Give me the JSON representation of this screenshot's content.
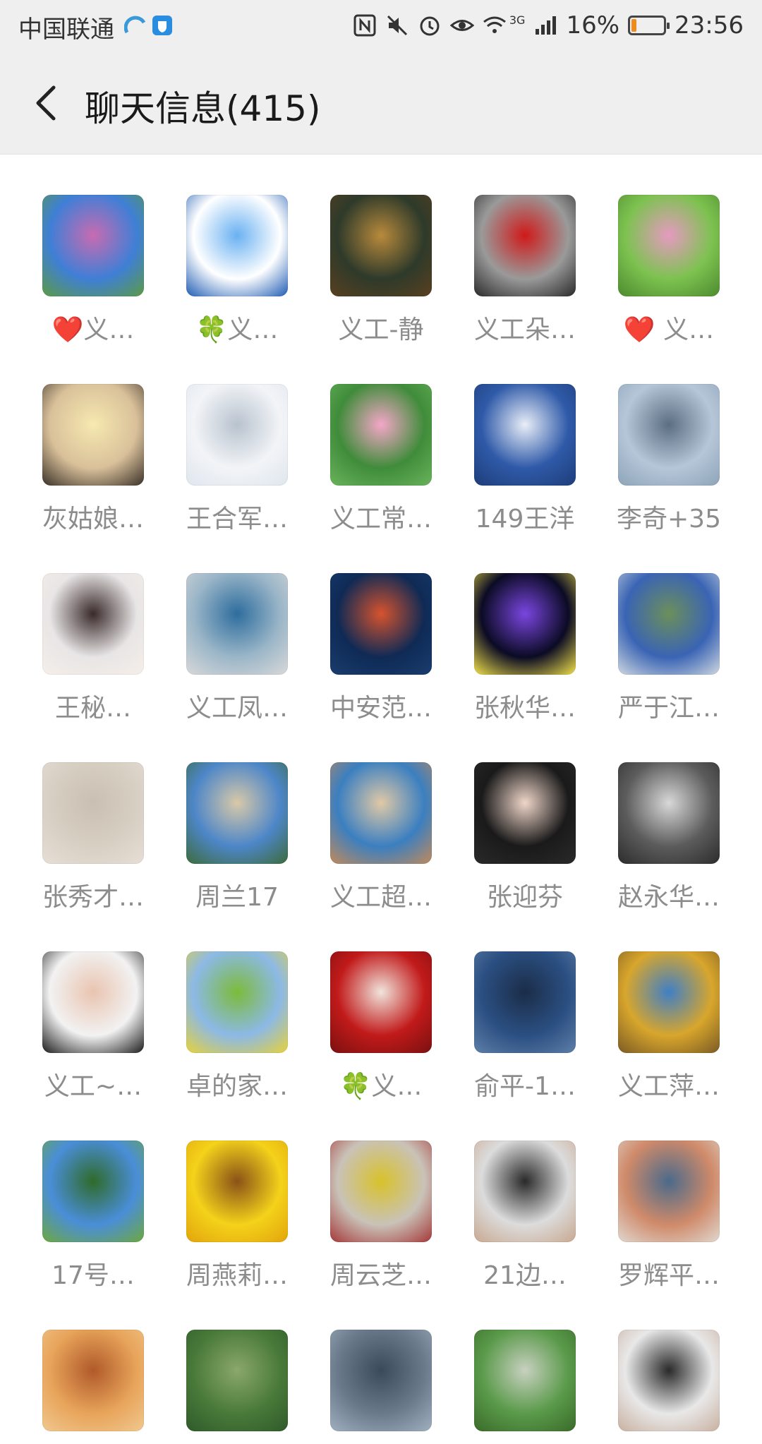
{
  "status_bar": {
    "carrier": "中国联通",
    "network": "3G",
    "battery": "16%",
    "battery_level": 0.16,
    "time": "23:56",
    "icons": [
      "nfc-icon",
      "mute-icon",
      "alarm-icon",
      "eye-comfort-icon",
      "wifi-icon",
      "signal-icon",
      "battery-icon"
    ]
  },
  "header": {
    "back_icon": "back-arrow-icon",
    "title": "聊天信息(415)"
  },
  "members": [
    {
      "name": "❤️义…",
      "photo": "pink-flowers-blue-sky"
    },
    {
      "name": "🍀义…",
      "photo": "blue-sun-burst"
    },
    {
      "name": "义工-静",
      "photo": "golden-dragon"
    },
    {
      "name": "义工朵…",
      "photo": "red-roses-bouquet"
    },
    {
      "name": "❤️ 义…",
      "photo": "pink-lotus-green"
    },
    {
      "name": "灰姑娘…",
      "photo": "sunset-field"
    },
    {
      "name": "王合军…",
      "photo": "snow-hands"
    },
    {
      "name": "义工常…",
      "photo": "pink-lotus"
    },
    {
      "name": "149王洋",
      "photo": "cloud-sky"
    },
    {
      "name": "李奇+35",
      "photo": "lake-landscape"
    },
    {
      "name": "王秘…",
      "photo": "woman-portrait"
    },
    {
      "name": "义工凤…",
      "photo": "ship-deck"
    },
    {
      "name": "中安范…",
      "photo": "cartoon-girl-night"
    },
    {
      "name": "张秋华…",
      "photo": "stage-lights"
    },
    {
      "name": "严于江…",
      "photo": "tower-trees"
    },
    {
      "name": "张秀才…",
      "photo": "beige-pattern"
    },
    {
      "name": "周兰17",
      "photo": "lakeside-buildings"
    },
    {
      "name": "义工超…",
      "photo": "beach-woman"
    },
    {
      "name": "张迎芬",
      "photo": "woman-selfie"
    },
    {
      "name": "赵永华…",
      "photo": "woman-glasses"
    },
    {
      "name": "义工~…",
      "photo": "woman-face"
    },
    {
      "name": "卓的家…",
      "photo": "flower-meadow"
    },
    {
      "name": "🍀义…",
      "photo": "red-blossoms"
    },
    {
      "name": "俞平-1…",
      "photo": "night-sea"
    },
    {
      "name": "义工萍…",
      "photo": "autumn-tree"
    },
    {
      "name": "17号…",
      "photo": "green-field"
    },
    {
      "name": "周燕莉…",
      "photo": "sunflower"
    },
    {
      "name": "周云芝…",
      "photo": "woman-flowers"
    },
    {
      "name": "21边…",
      "photo": "man-portrait"
    },
    {
      "name": "罗辉平…",
      "photo": "man-sunglasses"
    },
    {
      "name": "",
      "photo": "sunset-partial"
    },
    {
      "name": "",
      "photo": "trees-partial"
    },
    {
      "name": "",
      "photo": "people-partial"
    },
    {
      "name": "",
      "photo": "garden-partial"
    },
    {
      "name": "",
      "photo": "person-partial"
    }
  ]
}
